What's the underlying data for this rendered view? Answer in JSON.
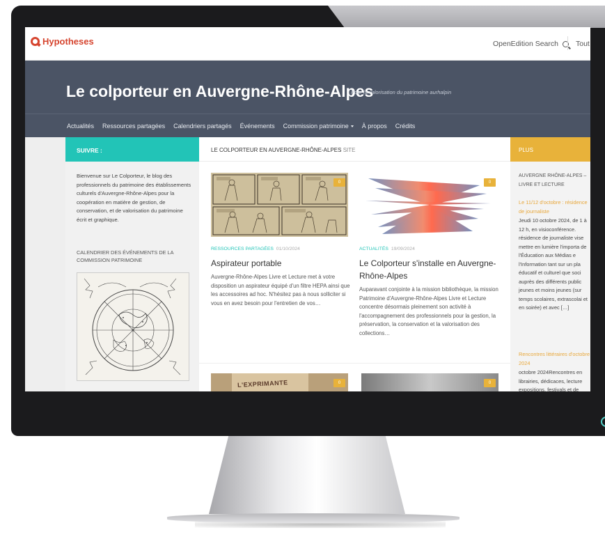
{
  "topbar": {
    "logo_text": "Hypotheses",
    "search_label": "OpenEdition Search",
    "tout_label": "Tout"
  },
  "hero": {
    "title": "Le colporteur en Auvergne-Rhône-Alpes",
    "tagline": "Pour la valorisation du patrimoine aurhalpin"
  },
  "nav": {
    "items": [
      "Actualités",
      "Ressources partagées",
      "Calendriers partagés",
      "Événements",
      "Commission patrimoine",
      "À propos",
      "Crédits"
    ]
  },
  "left": {
    "heading": "SUIVRE :",
    "intro": "Bienvenue sur Le Colporteur, le blog des professionnels du patrimoine des établissements culturels d'Auvergne-Rhône-Alpes pour la coopération en matière de gestion, de conservation, et de valorisation du patrimoine écrit et graphique.",
    "calendar_title": "CALENDRIER DES ÉVÉNEMENTS DE LA COMMISSION PATRIMOINE"
  },
  "main": {
    "heading": "LE COLPORTEUR EN AUVERGNE-RHÔNE-ALPES",
    "heading_sub": "SITE",
    "posts": [
      {
        "category": "RESSOURCES PARTAGÉES",
        "date": "01/10/2024",
        "title": "Aspirateur portable",
        "excerpt": "Auvergne-Rhône-Alpes Livre et Lecture met à votre disposition un aspirateur équipé d'un filtre HEPA ainsi que les accessoires ad hoc. N'hésitez pas à nous solliciter si vous en avez besoin pour l'entretien de vos…",
        "comments": "0"
      },
      {
        "category": "ACTUALITÉS",
        "date": "19/09/2024",
        "title": "Le Colporteur s'installe en Auvergne-Rhône-Alpes",
        "excerpt": "Auparavant conjointe à la mission bibliothèque, la mission Patrimoine d'Auvergne-Rhône-Alpes Livre et Lecture concentre désormais pleinement son activité à l'accompagnement des professionnels pour la gestion, la préservation, la conservation et la valorisation des collections…",
        "comments": "0"
      },
      {
        "comments": "0",
        "image_text": "L'EXPRIMANTE"
      },
      {
        "comments": "0"
      }
    ]
  },
  "right": {
    "heading": "PLUS",
    "section": "AUVERGNE RHÔNE-ALPES – LIVRE ET LECTURE",
    "link1": "Le 11/12 d'octobre : résidence de journaliste",
    "text1": "Jeudi 10 octobre 2024, de 1 à 12 h, en visioconférence. résidence de journaliste vise mettre en lumière l'importa de l'Éducation aux Médias e l'Information tant sur un pla éducatif et culturel que soci auprès des différents public jeunes et moins jeunes (sur temps scolaires, extrascolai et en soirée) et avec […]",
    "link2": "Rencontres littéraires d'octobre 2024",
    "text2": "octobre 2024Rencontres en librairies, dédicaces, lecture expositions, festivals et de fêtes du livre… Une sélection rendez-vous avec les auteu"
  },
  "colors": {
    "hero_bg": "#4b5465",
    "teal": "#22c4b7",
    "amber": "#e8b23a",
    "brand_red": "#d6452f"
  }
}
